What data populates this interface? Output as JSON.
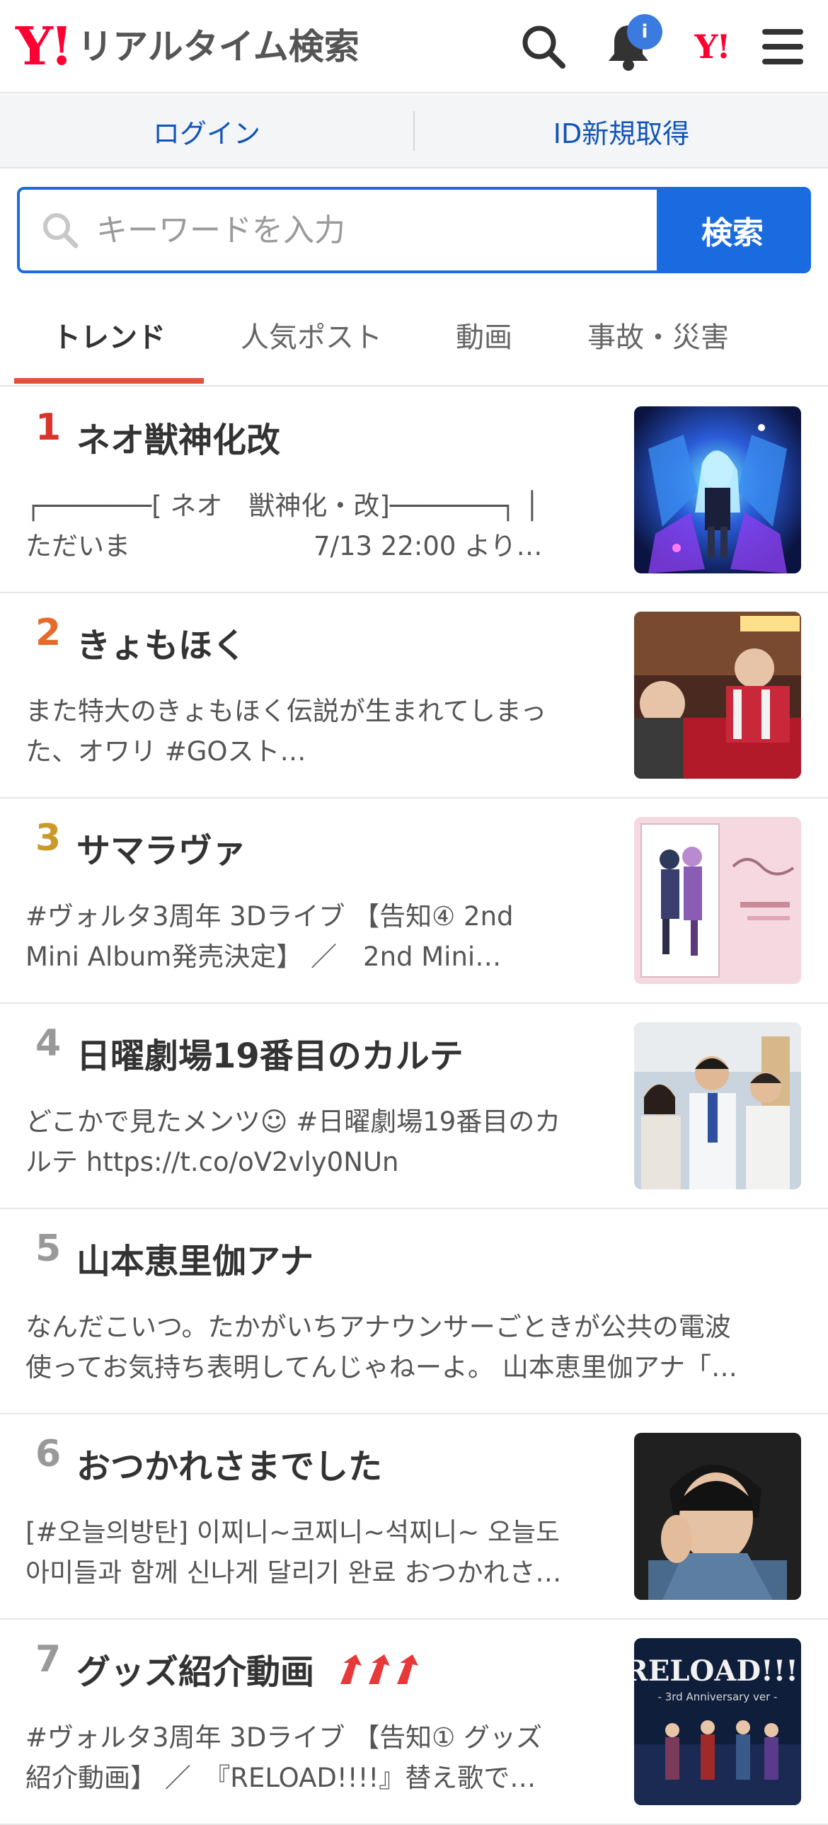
{
  "header": {
    "logo_mark": "Y!",
    "logo_title": "リアルタイム検索",
    "notification_badge": "i",
    "yahoo_mark": "Y!"
  },
  "loginbar": {
    "login": "ログイン",
    "signup": "ID新規取得"
  },
  "search": {
    "placeholder": "キーワードを入力",
    "button": "検索"
  },
  "tabs": [
    "トレンド",
    "人気ポスト",
    "動画",
    "事故・災害"
  ],
  "active_tab": "トレンド",
  "colors": {
    "brand": "#ff0033",
    "search_blue": "#1a6be0",
    "link_blue": "#1155b8",
    "tab_underline": "#e0523e",
    "rank_1": "#d9342b",
    "rank_2": "#e56b2d",
    "rank_3": "#c9992a",
    "rank_other": "#999999",
    "trend_arrow": "#e8393a"
  },
  "trends": [
    {
      "rank": "1",
      "title": "ネオ獣神化改",
      "desc_line1": "┌───────[ ネオ　獣神化・改]───────┐ │　 ",
      "desc_line2": "ただいま　　　　　　　7/13 22:00 より…",
      "has_thumb": true
    },
    {
      "rank": "2",
      "title": "きょもほく",
      "desc_line1": "また特大のきょもほく伝説が生まれてしまっ",
      "desc_line2": "た、オワリ #GOスト…",
      "has_thumb": true
    },
    {
      "rank": "3",
      "title": "サマラヴァ",
      "desc_line1": "#ヴォルタ3周年 3Dライブ 【告知④ 2nd",
      "desc_line2": "Mini Album発売決定】 ／　2nd Mini…",
      "has_thumb": true
    },
    {
      "rank": "4",
      "title": "日曜劇場19番目のカルテ",
      "desc_line1": "どこかで見たメンツ☺ #日曜劇場19番目のカ",
      "desc_line2": "ルテ https://t.co/oV2vly0NUn",
      "has_thumb": true
    },
    {
      "rank": "5",
      "title": "山本恵里伽アナ",
      "desc_line1": "なんだこいつ。たかがいちアナウンサーごときが公共の電波",
      "desc_line2": "使ってお気持ち表明してんじゃねーよ。 山本恵里伽アナ「…",
      "has_thumb": false
    },
    {
      "rank": "6",
      "title": "おつかれさまでした",
      "desc_line1": "[#오늘의방탄] 이찌니~코찌니~석찌니~ 오늘도",
      "desc_line2": "아미들과 함께 신나게 달리기 완료 おつかれさ…",
      "has_thumb": true
    },
    {
      "rank": "7",
      "title": "グッズ紹介動画",
      "desc_line1": "#ヴォルタ3周年 3Dライブ 【告知① グッズ",
      "desc_line2": "紹介動画】 ／　『RELOAD!!!!』替え歌で…",
      "has_thumb": true,
      "thumb_text": "RELOAD!!!!",
      "thumb_subtext": "- 3rd Anniversary ver -"
    }
  ]
}
